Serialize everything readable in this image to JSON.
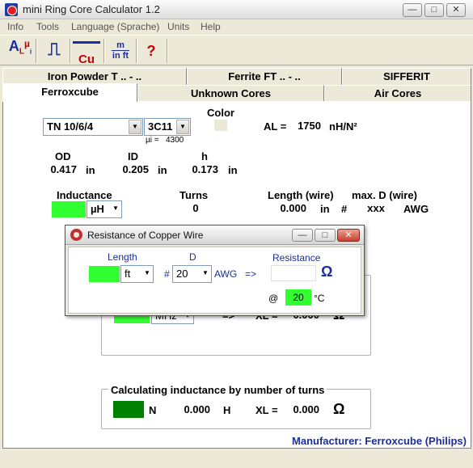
{
  "window": {
    "title": "mini Ring Core Calculator 1.2",
    "btn_min": "—",
    "btn_max": "□",
    "btn_close": "✕"
  },
  "menu": [
    "Info",
    "Tools",
    "Language (Sprache)",
    "Units",
    "Help"
  ],
  "toolbar": {
    "btn1_main": "A",
    "btn1_sub": "L",
    "btn1_mu": "µ",
    "btn1_i": "i",
    "btn2_label": "⎍",
    "btn3_label": "Cu",
    "btn4_top": "m",
    "btn4_bottom": "in ft",
    "btn5_label": "?"
  },
  "tabs_row1": [
    "Iron Powder T .. - ..",
    "Ferrite FT .. - ..",
    "SIFFERIT"
  ],
  "tabs_row2": [
    "Ferroxcube",
    "Unknown Cores",
    "Air Cores"
  ],
  "core": {
    "core_select": "TN 10/6/4",
    "material_select": "3C11",
    "mu_label": "µi =",
    "mu_value": "4300",
    "color_label": "Color",
    "al_label": "AL =",
    "al_value": "1750",
    "al_unit": "nH/N²"
  },
  "dims": {
    "od_label": "OD",
    "od_value": "0.417",
    "id_label": "ID",
    "id_value": "0.205",
    "h_label": "h",
    "h_value": "0.173",
    "unit": "in"
  },
  "winding": {
    "inductance_label": "Inductance",
    "inductance_unit": "µH",
    "turns_label": "Turns",
    "turns_value": "0",
    "length_label": "Length (wire)",
    "length_value": "0.000",
    "length_unit": "in",
    "hash": "#",
    "maxd_label": "max. D (wire)",
    "maxd_value": "xxx",
    "maxd_unit": "AWG"
  },
  "reactance_group": {
    "freq_unit": "MHz",
    "arrow": "=>",
    "xl_label": "XL =",
    "xl_value": "0.000",
    "omega": "Ω"
  },
  "turns_group": {
    "title": "Calculating inductance by number of turns",
    "n_label": "N",
    "l_value": "0.000",
    "l_unit": "H",
    "xl_label": "XL =",
    "xl_value": "0.000",
    "omega": "Ω"
  },
  "dialog": {
    "title": "Resistance of Copper Wire",
    "length_label": "Length",
    "length_unit": "ft",
    "d_label": "D",
    "hash": "#",
    "d_value": "20",
    "d_unit": "AWG",
    "arrow": "=>",
    "resistance_label": "Resistance",
    "omega": "Ω",
    "at_label": "@",
    "temp_value": "20",
    "temp_unit": "°C"
  },
  "footer": {
    "manufacturer": "Manufacturer: Ferroxcube (Philips)"
  }
}
